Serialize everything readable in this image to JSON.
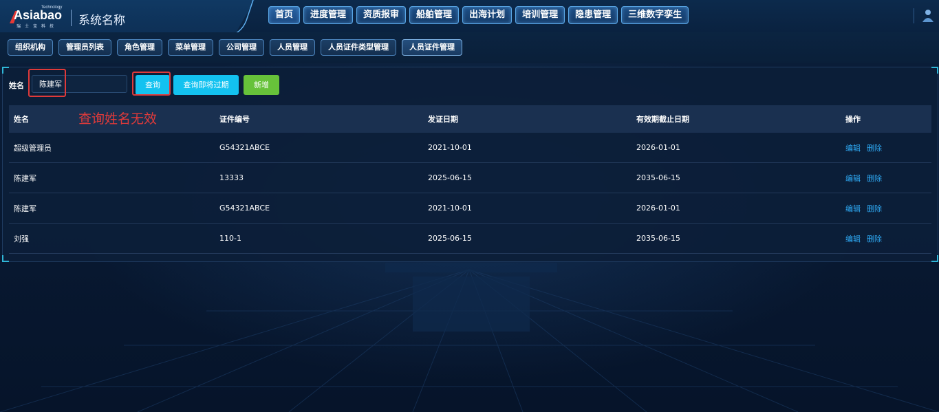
{
  "header": {
    "logo_word": "Asiabao",
    "logo_tech": "Technology",
    "logo_sub": "瑞士宝科技",
    "system_name": "系统名称",
    "nav": [
      {
        "label": "首页",
        "active": true
      },
      {
        "label": "进度管理"
      },
      {
        "label": "资质报审"
      },
      {
        "label": "船舶管理"
      },
      {
        "label": "出海计划"
      },
      {
        "label": "培训管理"
      },
      {
        "label": "隐患管理"
      },
      {
        "label": "三维数字孪生"
      }
    ]
  },
  "subtabs": [
    "组织机构",
    "管理员列表",
    "角色管理",
    "菜单管理",
    "公司管理",
    "人员管理",
    "人员证件类型管理",
    "人员证件管理"
  ],
  "search": {
    "label": "姓名",
    "value": "陈建军",
    "query_label": "查询",
    "expire_label": "查询即将过期",
    "add_label": "新增"
  },
  "annotation": "查询姓名无效",
  "table": {
    "headers": [
      "姓名",
      "证件编号",
      "发证日期",
      "有效期截止日期",
      "操作"
    ],
    "rows": [
      {
        "name": "超级管理员",
        "cert_no": "G54321ABCE",
        "issue": "2021-10-01",
        "expire": "2026-01-01"
      },
      {
        "name": "陈建军",
        "cert_no": "13333",
        "issue": "2025-06-15",
        "expire": "2035-06-15"
      },
      {
        "name": "陈建军",
        "cert_no": "G54321ABCE",
        "issue": "2021-10-01",
        "expire": "2026-01-01"
      },
      {
        "name": "刘强",
        "cert_no": "110-1",
        "issue": "2025-06-15",
        "expire": "2035-06-15"
      }
    ],
    "edit_label": "编辑",
    "delete_label": "删除"
  },
  "colors": {
    "accent": "#13c2f0",
    "success": "#67c23a",
    "link": "#2ea8f2",
    "annotation": "#e03a3a"
  }
}
